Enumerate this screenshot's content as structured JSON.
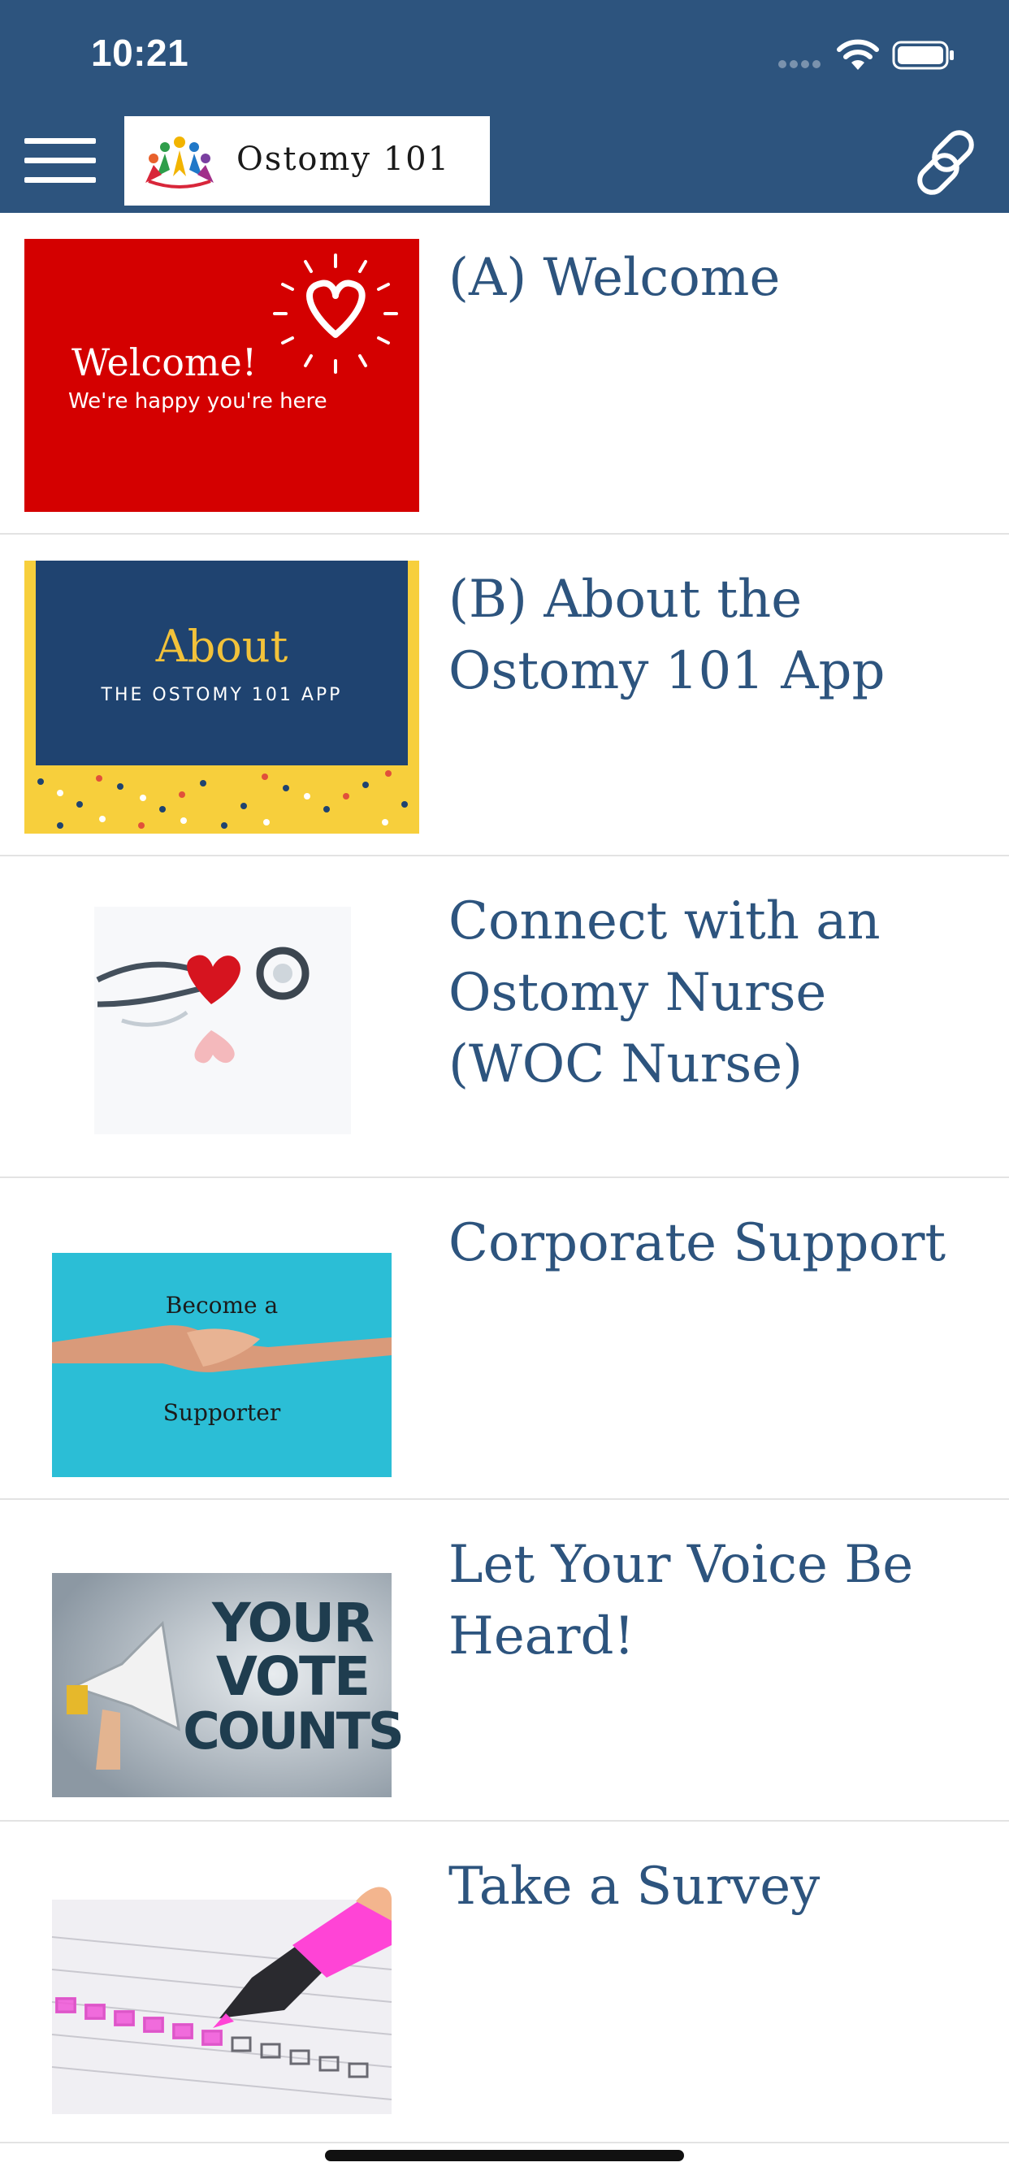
{
  "status_bar": {
    "time": "10:21"
  },
  "header": {
    "app_name": "Ostomy 101",
    "colors": {
      "bar": "#2d547e",
      "title_text": "#2d547e"
    }
  },
  "items": [
    {
      "label": "(A) Welcome",
      "thumb_text_1": "Welcome!",
      "thumb_text_2": "We're happy you're here"
    },
    {
      "label": "(B) About the Ostomy 101 App",
      "thumb_text_1": "About",
      "thumb_text_2": "THE OSTOMY 101 APP"
    },
    {
      "label": "Connect with an Ostomy Nurse (WOC Nurse)"
    },
    {
      "label": "Corporate Support",
      "thumb_text_1": "Become a",
      "thumb_text_2": "Supporter"
    },
    {
      "label": "Let Your Voice Be Heard!",
      "thumb_text_1": "YOUR",
      "thumb_text_2": "VOTE",
      "thumb_text_3": "COUNTS"
    },
    {
      "label": "Take a Survey"
    }
  ]
}
